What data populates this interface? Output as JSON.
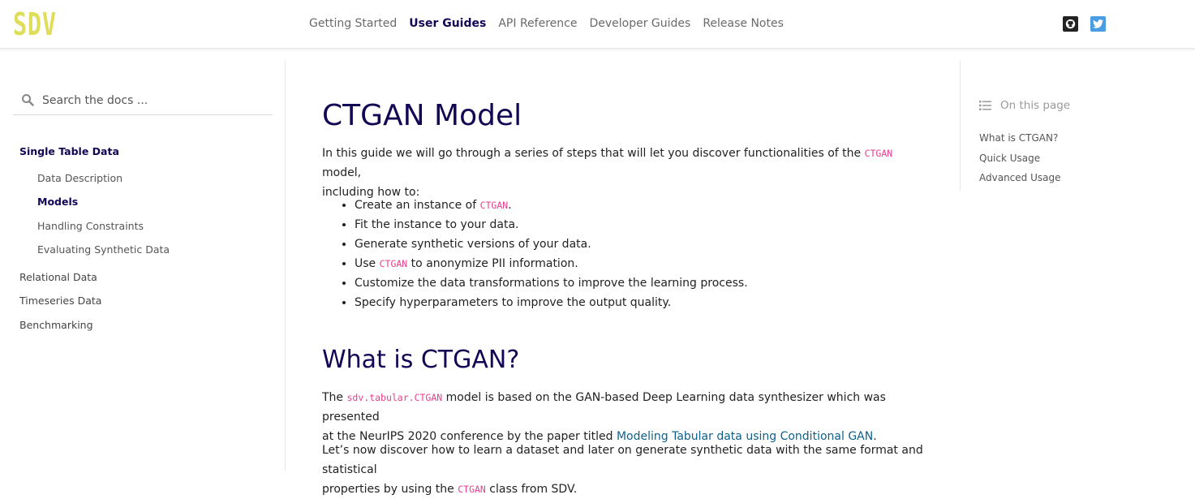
{
  "brand": {
    "logo_text": "SDV",
    "logo_color": "#dede5b",
    "accent_color": "#130654"
  },
  "topnav": {
    "items": [
      {
        "label": "Getting Started"
      },
      {
        "label": "User Guides"
      },
      {
        "label": "API Reference"
      },
      {
        "label": "Developer Guides"
      },
      {
        "label": "Release Notes"
      }
    ],
    "active": "User Guides"
  },
  "social": {
    "icons": [
      "github-icon",
      "twitter-icon"
    ]
  },
  "search": {
    "placeholder": "Search the docs ..."
  },
  "sidebar": {
    "items": [
      {
        "label": "Single Table Data"
      },
      {
        "label": "Data Description"
      },
      {
        "label": "Models"
      },
      {
        "label": "Handling Constraints"
      },
      {
        "label": "Evaluating Synthetic Data"
      },
      {
        "label": "Relational Data"
      },
      {
        "label": "Timeseries Data"
      },
      {
        "label": "Benchmarking"
      }
    ]
  },
  "main": {
    "title": "CTGAN Model",
    "intro_a": "In this guide we will go through a series of steps that will let you discover functionalities of the ",
    "intro_code": "CTGAN",
    "intro_b": " model,",
    "intro_c": "including how to:",
    "bullets": [
      {
        "a": "Create an instance of ",
        "code": "CTGAN",
        "b": "."
      },
      {
        "a": "Fit the instance to your data.",
        "code": "",
        "b": ""
      },
      {
        "a": "Generate synthetic versions of your data.",
        "code": "",
        "b": ""
      },
      {
        "a": "Use ",
        "code": "CTGAN",
        "b": " to anonymize PII information."
      },
      {
        "a": "Customize the data transformations to improve the learning process.",
        "code": "",
        "b": ""
      },
      {
        "a": "Specify hyperparameters to improve the output quality.",
        "code": "",
        "b": ""
      }
    ],
    "section_title": "What is CTGAN?",
    "p1_a": "The ",
    "p1_code": "sdv.tabular.CTGAN",
    "p1_b": " model is based on the GAN-based Deep Learning data synthesizer which was presented",
    "p1_c": "at the NeurIPS 2020 conference by the paper titled ",
    "p1_link": "Modeling Tabular data using Conditional GAN",
    "p1_d": ".",
    "p2_a": "Let’s now discover how to learn a dataset and later on generate synthetic data with the same format and statistical",
    "p2_b": "properties by using the ",
    "p2_code": "CTGAN",
    "p2_c": " class from SDV."
  },
  "toc": {
    "title": "On this page",
    "items": [
      {
        "label": "What is CTGAN?"
      },
      {
        "label": "Quick Usage"
      },
      {
        "label": "Advanced Usage"
      }
    ]
  }
}
